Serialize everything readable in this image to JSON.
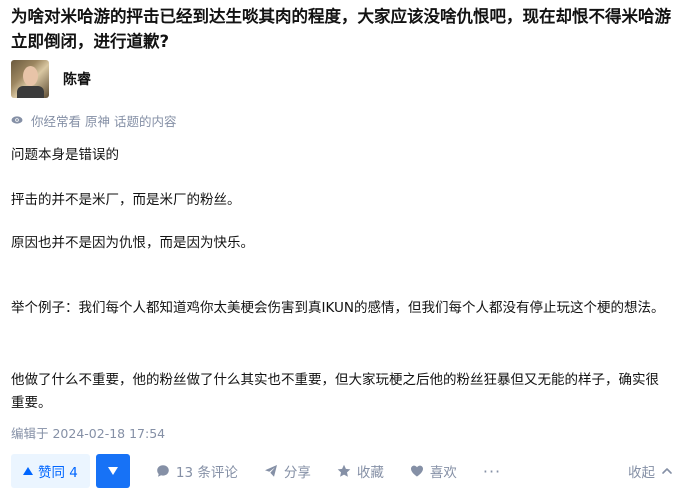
{
  "question": {
    "title": "为啥对米哈游的抨击已经到达生啖其肉的程度，大家应该没啥仇恨吧，现在却恨不得米哈游立即倒闭，进行道歉?"
  },
  "author": {
    "name": "陈睿"
  },
  "meta": {
    "tags": [
      "你经常看",
      "原神",
      "话题的内容"
    ]
  },
  "answer": {
    "paragraphs": [
      "问题本身是错误的",
      "抨击的并不是米厂，而是米厂的粉丝。",
      "原因也并不是因为仇恨，而是因为快乐。",
      "举个例子：我们每个人都知道鸡你太美梗会伤害到真IKUN的感情，但我们每个人都没有停止玩这个梗的想法。",
      "他做了什么不重要，他的粉丝做了什么其实也不重要，但大家玩梗之后他的粉丝狂暴但又无能的样子，确实很重要。"
    ],
    "edited": "编辑于 2024-02-18 17:54"
  },
  "actions": {
    "upvote_label": "赞同 4",
    "comment_label": "13 条评论",
    "share_label": "分享",
    "favorite_label": "收藏",
    "like_label": "喜欢",
    "more_label": "···",
    "collapse_label": "收起"
  },
  "colors": {
    "accent": "#0066ff",
    "accent_bg": "#ebf5ff",
    "muted": "#8590a6",
    "text": "#121212"
  }
}
